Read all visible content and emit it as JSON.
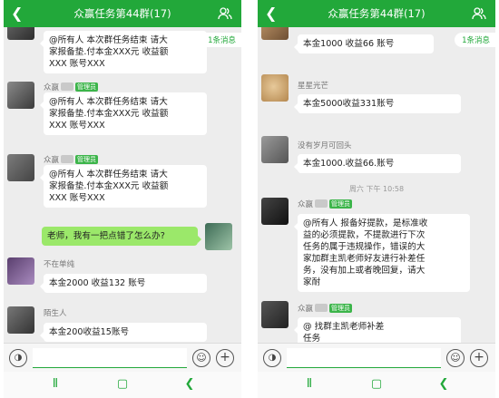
{
  "title": "众赢任务第44群(17)",
  "colors": {
    "accent": "#22a83a",
    "bubble_sent": "#9be86a",
    "chat_bg": "#ededed"
  },
  "icons": {
    "back": "back-arrow-icon",
    "members": "group-members-icon",
    "voice": "voice-icon",
    "emoji": "emoji-icon",
    "more": "plus-icon",
    "nav_menu": "menu-icon",
    "nav_home": "home-icon",
    "nav_back": "back-icon"
  },
  "left": {
    "new_messages": "1条消息",
    "messages": [
      {
        "text": "@所有人  本次群任务结束 请大\n家报备垫.付本金XXX元 收益额\nXXX 账号XXX"
      },
      {
        "sender": "众赢",
        "badge": "管理员",
        "text": "@所有人  本次群任务结束 请大\n家报备垫.付本金XXX元 收益额\nXXX 账号XXX"
      },
      {
        "sender": "众赢",
        "badge": "管理员",
        "text": "@所有人  本次群任务结束 请大\n家报备垫.付本金XXX元 收益额\nXXX 账号XXX"
      },
      {
        "text": "老师，我有一把点错了怎么办?"
      },
      {
        "sender": "不在单纯",
        "text": "本金2000 收益132 账号"
      },
      {
        "sender": "陌生人",
        "text": "本金200收益15账号"
      }
    ]
  },
  "right": {
    "new_messages": "1条消息",
    "timestamp": "周六 下午 10:58",
    "messages": [
      {
        "text": "本金1000  收益66 账号"
      },
      {
        "sender": "星星光芒",
        "text": "本金5000收益331账号"
      },
      {
        "sender": "没有岁月可回头",
        "text": "本金1000.收益66.账号"
      },
      {
        "sender": "众赢",
        "badge": "管理员",
        "text": "@所有人 报备好提款，是标准收\n益的必须提款，不提款进行下次\n任务的属于违规操作，错误的大\n家加群主凯老师好友进行补差任\n务，没有加上或者晚回复，请大\n家耐"
      },
      {
        "sender": "众赢",
        "badge": "管理员",
        "text": "@         找群主凯老师补差\n任务"
      }
    ]
  }
}
